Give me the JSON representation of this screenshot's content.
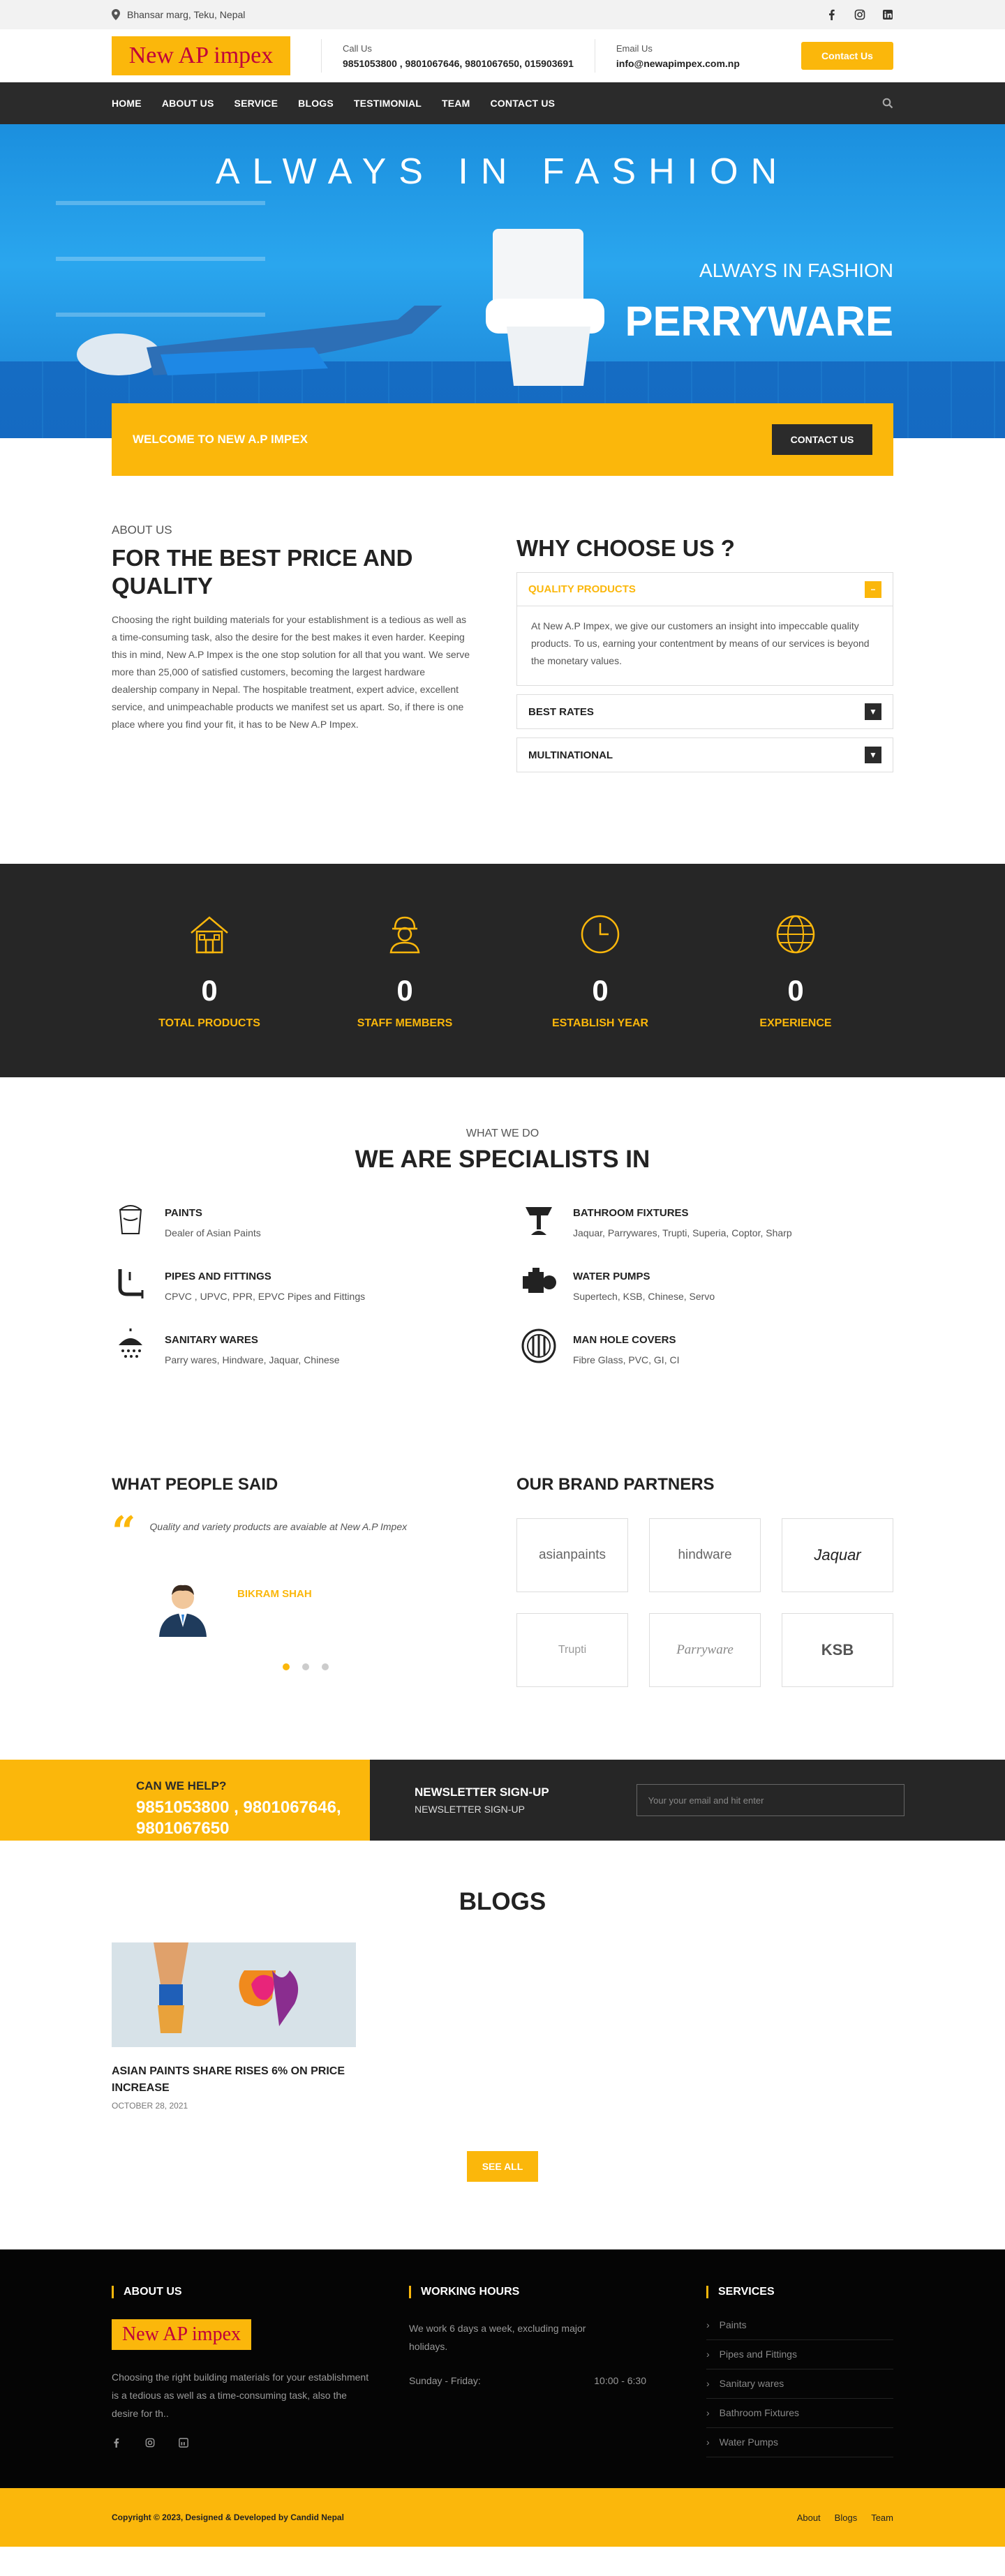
{
  "topbar": {
    "address": "Bhansar marg, Teku, Nepal",
    "social_icons": [
      "facebook-icon",
      "instagram-icon",
      "linkedin-icon"
    ]
  },
  "header": {
    "logo_text": "New AP impex",
    "call_label": "Call Us",
    "call_value": "9851053800 , 9801067646, 9801067650, 015903691",
    "email_label": "Email Us",
    "email_value": "info@newapimpex.com.np",
    "contact_button": "Contact Us"
  },
  "nav": {
    "items": [
      "HOME",
      "ABOUT US",
      "SERVICE",
      "BLOGS",
      "TESTIMONIAL",
      "TEAM",
      "CONTACT US"
    ]
  },
  "hero": {
    "tagline": "ALWAYS IN FASHION",
    "subtitle": "ALWAYS IN FASHION",
    "title": "PERRYWARE"
  },
  "welcome": {
    "text": "WELCOME TO NEW A.P IMPEX",
    "button": "CONTACT US"
  },
  "about": {
    "eyebrow": "ABOUT US",
    "heading": "FOR THE BEST PRICE AND QUALITY",
    "body": "Choosing the right building materials for your establishment is a tedious as well as a time-consuming task, also the desire for the best makes it even harder. Keeping this in mind, New A.P Impex is the one stop solution for all that you want. We serve more than 25,000 of satisfied customers, becoming the largest hardware dealership company in Nepal. The hospitable treatment, expert advice, excellent service, and unimpeachable products we manifest set us apart. So, if there is one place where you find your fit, it has to be New A.P Impex."
  },
  "why": {
    "heading": "WHY CHOOSE US ?",
    "items": [
      {
        "title": "QUALITY PRODUCTS",
        "toggle": "−",
        "body": "At New A.P Impex, we give our customers an insight into impeccable quality products. To us, earning your contentment by means of our services is beyond the monetary values."
      },
      {
        "title": "BEST RATES",
        "toggle": "▼"
      },
      {
        "title": "MULTINATIONAL",
        "toggle": "▼"
      }
    ]
  },
  "stats": [
    {
      "icon": "house-icon",
      "value": "0",
      "label": "TOTAL PRODUCTS"
    },
    {
      "icon": "worker-icon",
      "value": "0",
      "label": "STAFF MEMBERS"
    },
    {
      "icon": "clock-icon",
      "value": "0",
      "label": "ESTABLISH YEAR"
    },
    {
      "icon": "globe-icon",
      "value": "0",
      "label": "EXPERIENCE"
    }
  ],
  "specialists": {
    "eyebrow": "WHAT WE DO",
    "heading": "WE ARE SPECIALISTS IN",
    "items": [
      {
        "icon": "paint-bucket-icon",
        "title": "PAINTS",
        "desc": "Dealer of Asian Paints"
      },
      {
        "icon": "basin-icon",
        "title": "BATHROOM FIXTURES",
        "desc": "Jaquar, Parrywares, Trupti, Superia, Coptor, Sharp"
      },
      {
        "icon": "pipe-icon",
        "title": "PIPES AND FITTINGS",
        "desc": "CPVC , UPVC, PPR, EPVC Pipes and Fittings"
      },
      {
        "icon": "pump-icon",
        "title": "WATER PUMPS",
        "desc": "Supertech, KSB, Chinese, Servo"
      },
      {
        "icon": "shower-icon",
        "title": "SANITARY WARES",
        "desc": "Parry wares, Hindware, Jaquar, Chinese"
      },
      {
        "icon": "manhole-icon",
        "title": "MAN HOLE COVERS",
        "desc": "Fibre Glass, PVC, GI, CI"
      }
    ]
  },
  "testimonials": {
    "heading": "WHAT PEOPLE SAID",
    "quote": "Quality and variety products are avaiable at New A.P Impex",
    "name": "BIKRAM SHAH"
  },
  "brands": {
    "heading": "OUR BRAND PARTNERS",
    "items": [
      "asianpaints",
      "hindware",
      "Jaquar",
      "Trupti",
      "Parryware",
      "KSB"
    ]
  },
  "help": {
    "title": "CAN WE HELP?",
    "phones": "9851053800 , 9801067646, 9801067650",
    "newsletter_title": "NEWSLETTER SIGN-UP",
    "newsletter_sub": "NEWSLETTER SIGN-UP",
    "placeholder": "Your your email and hit enter"
  },
  "blogs": {
    "heading": "BLOGS",
    "post_title": "ASIAN PAINTS SHARE RISES 6% ON PRICE INCREASE",
    "post_date": "OCTOBER 28, 2021",
    "see_all": "SEE ALL"
  },
  "footer": {
    "about_heading": "ABOUT US",
    "logo_text": "New AP impex",
    "about_text": "Choosing the right building materials for your establishment is a tedious as well as a time-consuming task, also the desire for th..",
    "hours_heading": "WORKING HOURS",
    "hours_text": "We work 6 days a week, excluding major holidays.",
    "hours_day": "Sunday - Friday:",
    "hours_time": "10:00 - 6:30",
    "services_heading": "SERVICES",
    "services": [
      "Paints",
      "Pipes and Fittings",
      "Sanitary wares",
      "Bathroom Fixtures",
      "Water Pumps"
    ],
    "copyright": "Copyright © 2023, Designed & Developed by Candid Nepal",
    "links": [
      "About",
      "Blogs",
      "Team"
    ]
  },
  "colors": {
    "accent": "#fbb70b",
    "dark": "#2b2b2b",
    "footer": "#050505"
  }
}
